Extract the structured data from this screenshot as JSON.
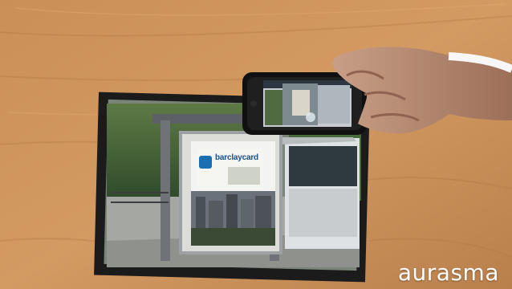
{
  "scene": {
    "ad_brand_text": "barclaycard",
    "watermark_text": "aurasma"
  }
}
